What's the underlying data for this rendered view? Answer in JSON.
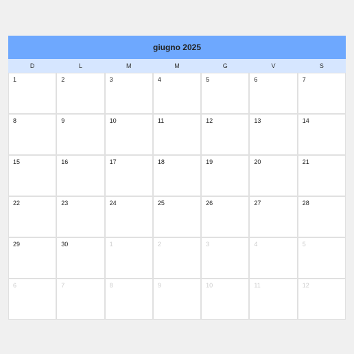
{
  "calendar": {
    "title": "giugno 2025",
    "weekdays": [
      "D",
      "L",
      "M",
      "M",
      "G",
      "V",
      "S"
    ],
    "cells": [
      {
        "day": "1",
        "current": true
      },
      {
        "day": "2",
        "current": true
      },
      {
        "day": "3",
        "current": true
      },
      {
        "day": "4",
        "current": true
      },
      {
        "day": "5",
        "current": true
      },
      {
        "day": "6",
        "current": true
      },
      {
        "day": "7",
        "current": true
      },
      {
        "day": "8",
        "current": true
      },
      {
        "day": "9",
        "current": true
      },
      {
        "day": "10",
        "current": true
      },
      {
        "day": "11",
        "current": true
      },
      {
        "day": "12",
        "current": true
      },
      {
        "day": "13",
        "current": true
      },
      {
        "day": "14",
        "current": true
      },
      {
        "day": "15",
        "current": true
      },
      {
        "day": "16",
        "current": true
      },
      {
        "day": "17",
        "current": true
      },
      {
        "day": "18",
        "current": true
      },
      {
        "day": "19",
        "current": true
      },
      {
        "day": "20",
        "current": true
      },
      {
        "day": "21",
        "current": true
      },
      {
        "day": "22",
        "current": true
      },
      {
        "day": "23",
        "current": true
      },
      {
        "day": "24",
        "current": true
      },
      {
        "day": "25",
        "current": true
      },
      {
        "day": "26",
        "current": true
      },
      {
        "day": "27",
        "current": true
      },
      {
        "day": "28",
        "current": true
      },
      {
        "day": "29",
        "current": true
      },
      {
        "day": "30",
        "current": true
      },
      {
        "day": "1",
        "current": false
      },
      {
        "day": "2",
        "current": false
      },
      {
        "day": "3",
        "current": false
      },
      {
        "day": "4",
        "current": false
      },
      {
        "day": "5",
        "current": false
      },
      {
        "day": "6",
        "current": false
      },
      {
        "day": "7",
        "current": false
      },
      {
        "day": "8",
        "current": false
      },
      {
        "day": "9",
        "current": false
      },
      {
        "day": "10",
        "current": false
      },
      {
        "day": "11",
        "current": false
      },
      {
        "day": "12",
        "current": false
      }
    ]
  }
}
